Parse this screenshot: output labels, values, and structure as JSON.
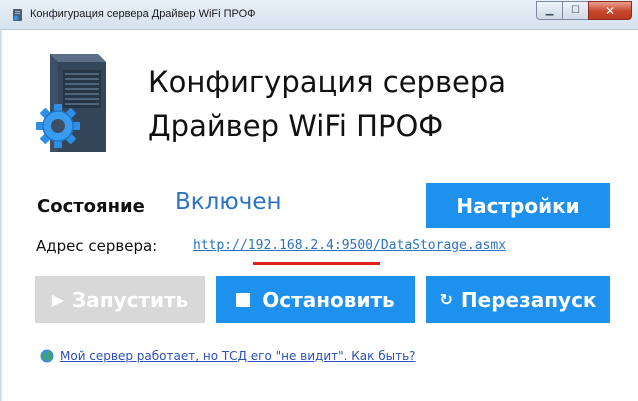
{
  "window": {
    "title": "Конфигурация сервера Драйвер WiFi ПРОФ",
    "minimize_glyph": "▁",
    "maximize_glyph": "☐",
    "close_glyph": "✕"
  },
  "header": {
    "title_line1": "Конфигурация сервера",
    "title_line2": "Драйвер WiFi ПРОФ",
    "icon": "server-gear-icon"
  },
  "status": {
    "label": "Состояние",
    "value": "Включен"
  },
  "settings_button": {
    "label": "Настройки"
  },
  "address": {
    "label": "Адрес сервера:",
    "url": "http://192.168.2.4:9500/DataStorage.asmx"
  },
  "actions": {
    "start": {
      "glyph": "▶",
      "label": "Запустить",
      "enabled": false
    },
    "stop": {
      "label": "Остановить",
      "enabled": true
    },
    "restart": {
      "glyph": "↻",
      "label": "Перезапуск",
      "enabled": true
    }
  },
  "help": {
    "icon": "globe-icon",
    "link_text": "Мой сервер работает, но ТСД его \"не видит\". Как быть?"
  },
  "colors": {
    "accent": "#1e90ee",
    "link": "#2b72c4",
    "disabled": "#d8d8d8",
    "highlight": "#e0201a"
  }
}
